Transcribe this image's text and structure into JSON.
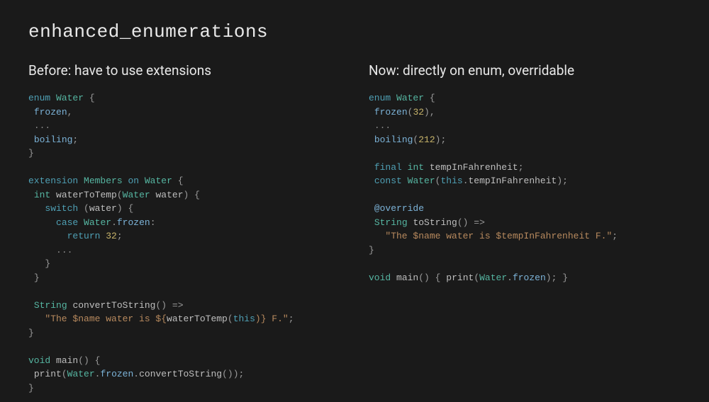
{
  "title": "enhanced_enumerations",
  "left": {
    "heading": "Before: have to use extensions",
    "t": {
      "kw_enum": "enum",
      "type_water": "Water",
      "mem_frozen": "frozen",
      "mem_boiling": "boiling",
      "ellipsis": "...",
      "kw_extension": "extension",
      "type_members": "Members",
      "kw_on": "on",
      "type_int": "int",
      "fn_waterToTemp": "waterToTemp",
      "param_water": "water",
      "kw_switch": "switch",
      "kw_case": "case",
      "kw_return": "return",
      "lit_32": "32",
      "type_string": "String",
      "fn_convertToString": "convertToString",
      "str_before1": "\"The $name water is ${",
      "str_before_call": "waterToTemp",
      "kw_this": "this",
      "str_before2": ")} F.\"",
      "type_void": "void",
      "fn_main": "main",
      "fn_print": "print"
    }
  },
  "right": {
    "heading": "Now: directly on enum, overridable",
    "t": {
      "kw_enum": "enum",
      "type_water": "Water",
      "mem_frozen": "frozen",
      "mem_boiling": "boiling",
      "lit_32": "32",
      "lit_212": "212",
      "ellipsis": "...",
      "kw_final": "final",
      "type_int": "int",
      "field_temp": "tempInFahrenheit",
      "kw_const": "const",
      "kw_this": "this",
      "ann_override": "@override",
      "type_string": "String",
      "fn_toString": "toString",
      "str_now": "\"The $name water is $tempInFahrenheit F.\"",
      "type_void": "void",
      "fn_main": "main",
      "fn_print": "print"
    }
  }
}
